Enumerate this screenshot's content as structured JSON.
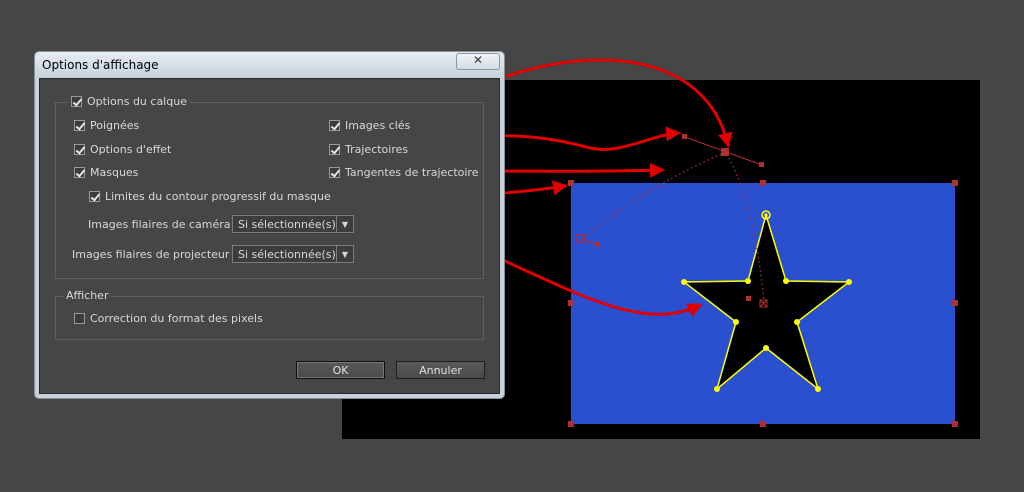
{
  "dialog": {
    "title": "Options d'affichage",
    "layer_group": {
      "title": "Options du calque",
      "checked": true,
      "left_options": [
        {
          "label": "Poignées",
          "checked": true
        },
        {
          "label": "Options d'effet",
          "checked": true
        },
        {
          "label": "Masques",
          "checked": true
        }
      ],
      "right_options": [
        {
          "label": "Images clés",
          "checked": true
        },
        {
          "label": "Trajectoires",
          "checked": true
        },
        {
          "label": "Tangentes de trajectoire",
          "checked": true
        }
      ],
      "sub_option": {
        "label": "Limites du contour progressif du masque",
        "checked": true
      },
      "camera_wireframes": {
        "label": "Images filaires de caméra :",
        "value": "Si sélectionnée(s)"
      },
      "projector_wireframes": {
        "label": "Images filaires de projecteur :",
        "value": "Si sélectionnée(s)"
      }
    },
    "display_group": {
      "title": "Afficher",
      "pixel_aspect": {
        "label": "Correction du format des pixels",
        "checked": false
      }
    },
    "ok_label": "OK",
    "cancel_label": "Annuler"
  },
  "colors": {
    "arrow": "#e00000",
    "layer_fill": "#2a4fcf",
    "star_stroke": "#ffff00",
    "handle": "#b03030"
  }
}
